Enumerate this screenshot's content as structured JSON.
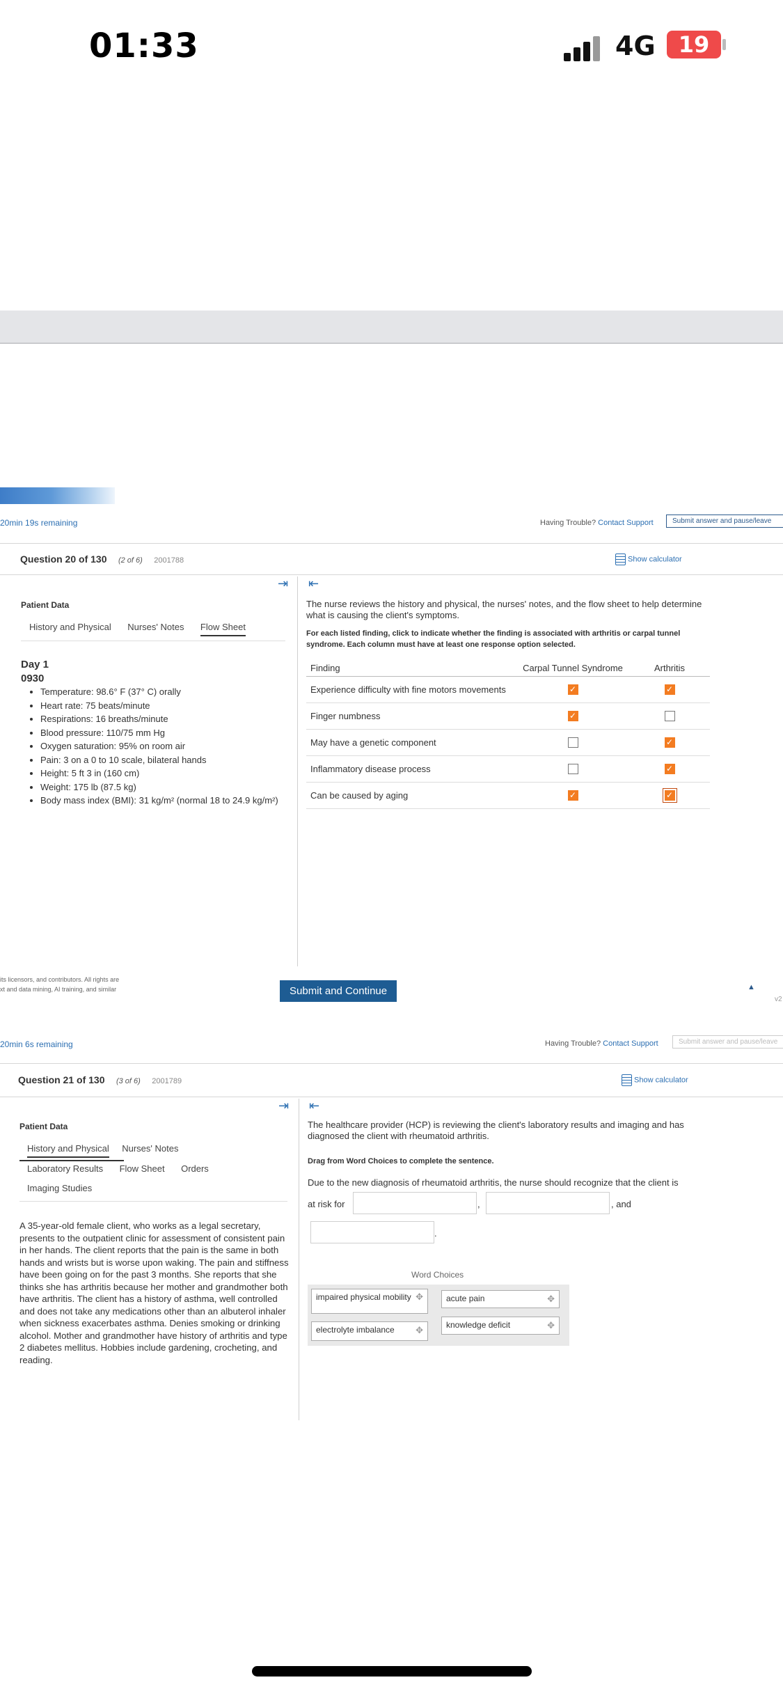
{
  "status_bar": {
    "time": "01:33",
    "network": "4G",
    "battery": "19"
  },
  "q20": {
    "timer": "20min 19s remaining",
    "having_trouble": "Having Trouble?",
    "contact_support": "Contact Support",
    "submit_pause": "Submit answer and pause/leave",
    "title": "Question 20 of 130",
    "sub": "(2 of 6)",
    "id": "2001788",
    "show_calculator": "Show calculator",
    "patient_data": "Patient Data",
    "tabs": [
      "History and Physical",
      "Nurses' Notes",
      "Flow Sheet"
    ],
    "day": "Day 1",
    "time": "0930",
    "vitals": [
      "Temperature: 98.6° F (37° C) orally",
      "Heart rate: 75 beats/minute",
      "Respirations: 16 breaths/minute",
      "Blood pressure: 110/75 mm Hg",
      "Oxygen saturation: 95% on room air",
      "Pain: 3 on a 0 to 10 scale, bilateral hands",
      "Height: 5 ft 3 in (160 cm)",
      "Weight: 175 lb (87.5 kg)",
      "Body mass index (BMI): 31 kg/m² (normal 18 to 24.9 kg/m²)"
    ],
    "prompt": "The nurse reviews the history and physical, the nurses' notes, and the flow sheet to help determine what is causing the client's symptoms.",
    "instruction": "For each listed finding, click to indicate whether the finding is associated with arthritis or carpal tunnel syndrome. Each column must have at least one response option selected.",
    "col_finding": "Finding",
    "col_cts": "Carpal Tunnel Syndrome",
    "col_arthritis": "Arthritis",
    "rows": [
      {
        "finding": "Experience difficulty with fine motors movements",
        "cts": true,
        "arthritis": true
      },
      {
        "finding": "Finger numbness",
        "cts": true,
        "arthritis": false
      },
      {
        "finding": "May have a genetic component",
        "cts": false,
        "arthritis": true
      },
      {
        "finding": "Inflammatory disease process",
        "cts": false,
        "arthritis": true
      },
      {
        "finding": "Can be caused by aging",
        "cts": true,
        "arthritis": true
      }
    ],
    "copyright_1": "its licensors, and contributors. All rights are",
    "copyright_2": "xt and data mining, AI training, and similar",
    "submit_continue": "Submit and Continue",
    "top_arrow": "▲",
    "version": "v2"
  },
  "q21": {
    "timer": "20min 6s remaining",
    "having_trouble": "Having Trouble?",
    "contact_support": "Contact Support",
    "submit_pause": "Submit answer and pause/leave",
    "title": "Question 21 of 130",
    "sub": "(3 of 6)",
    "id": "2001789",
    "show_calculator": "Show calculator",
    "patient_data": "Patient Data",
    "tabs_row1": [
      "History and Physical",
      "Nurses' Notes"
    ],
    "tabs_row2": [
      "Laboratory Results",
      "Flow Sheet",
      "Orders"
    ],
    "tabs_row3": [
      "Imaging Studies"
    ],
    "scenario": "A 35-year-old female client, who works as a legal secretary, presents to the outpatient clinic for assessment of consistent pain in her hands. The client reports that the pain is the same in both hands and wrists but is worse upon waking. The pain and stiffness have been going on for the past 3 months. She reports that she thinks she has arthritis because her mother and grandmother both have arthritis. The client has a history of asthma, well controlled and does not take any medications other than an albuterol inhaler when sickness exacerbates asthma. Denies smoking or drinking alcohol. Mother and grandmother have history of arthritis and type 2 diabetes mellitus. Hobbies include gardening, crocheting, and reading.",
    "prompt": "The healthcare provider (HCP) is reviewing the client's laboratory results and imaging and has diagnosed the client with rheumatoid arthritis.",
    "instruction": "Drag from Word Choices to complete the sentence.",
    "sentence_start": "Due to the new diagnosis of rheumatoid arthritis, the nurse should recognize that the client is",
    "at_risk_for": "at risk for",
    "comma": ",",
    "and": ", and",
    "period": ".",
    "word_choices_title": "Word Choices",
    "word_choices": [
      "impaired physical mobility",
      "acute pain",
      "electrolyte imbalance",
      "knowledge deficit"
    ]
  }
}
